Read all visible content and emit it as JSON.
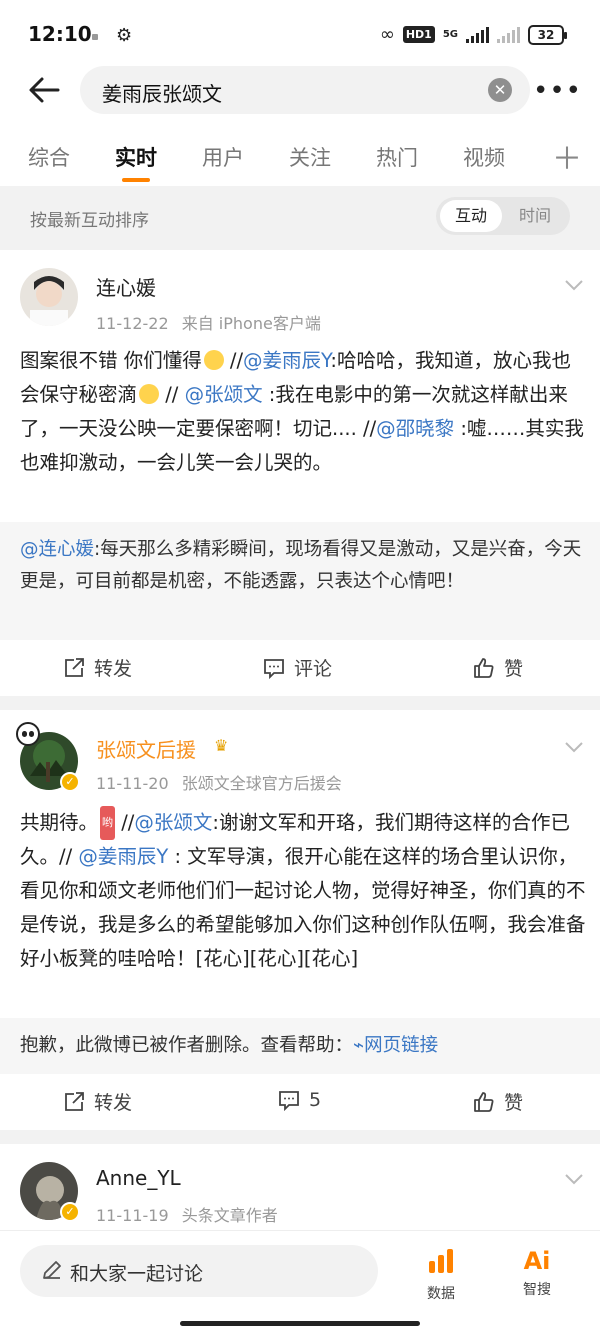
{
  "status_bar": {
    "time": "12:10",
    "hd": "HD1",
    "net": "5G",
    "battery": "32"
  },
  "search": {
    "query": "姜雨辰张颂文",
    "clear_icon": "close-circle-icon",
    "more_icon": "more-dots-icon"
  },
  "tabs": [
    "综合",
    "实时",
    "用户",
    "关注",
    "热门",
    "视频"
  ],
  "active_tab": "实时",
  "sort": {
    "label": "按最新互动排序",
    "options": [
      "互动",
      "时间"
    ],
    "selected": "互动"
  },
  "posts": [
    {
      "author": "连心媛",
      "time": "11-12-22",
      "source": "来自 iPhone客户端",
      "text": {
        "p1": "图案很不错 你们懂得",
        "p2": " //",
        "m1": "@姜雨辰Y",
        "p3": ":哈哈哈，我知道，放心我也会保守秘密滴",
        "p4": " // ",
        "m2": "@张颂文",
        "p5": " :我在电影中的第一次就这样献出来了，一天没公映一定要保密啊！切记.... //",
        "m3": "@邵晓黎",
        "p6": " :嘘……其实我也难抑激动，一会儿笑一会儿哭的。"
      },
      "repost": {
        "mention": "@连心媛",
        "text": ":每天那么多精彩瞬间，现场看得又是激动，又是兴奋，今天更是，可目前都是机密，不能透露，只表达个心情吧！"
      },
      "actions": {
        "forward": "转发",
        "comment": "评论",
        "like": "赞"
      }
    },
    {
      "author": "张颂文后援",
      "time": "11-11-20",
      "source": "张颂文全球官方后援会",
      "text": {
        "p1": "共期待。",
        "tag": "哟",
        "p2": " //",
        "m1": "@张颂文",
        "p3": ":谢谢文军和开珞，我们期待这样的合作已久。// ",
        "m2": "@姜雨辰Y",
        "p4": " : 文军导演，很开心能在这样的场合里认识你，看见你和颂文老师他们们一起讨论人物，觉得好神圣，你们真的不是传说，我是多么的希望能够加入你们这种创作队伍啊，我会准备好小板凳的哇哈哈！[花心][花心][花心]"
      },
      "repost": {
        "text": "抱歉，此微博已被作者删除。查看帮助：",
        "link": "网页链接"
      },
      "actions": {
        "forward": "转发",
        "comment": "5",
        "like": "赞"
      }
    },
    {
      "author": "Anne_YL",
      "time": "11-11-19",
      "source": "头条文章作者"
    }
  ],
  "bottom_bar": {
    "discuss_placeholder": "和大家一起讨论",
    "data_label": "数据",
    "search_label": "智搜",
    "search_icon_text": "Ai"
  },
  "colors": {
    "accent": "#ff8200",
    "mention": "#3b77c4",
    "vip_name": "#f7901e"
  }
}
